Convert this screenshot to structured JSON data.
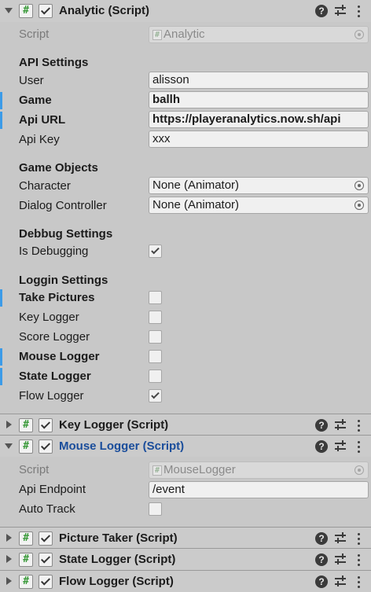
{
  "components": {
    "analytic": {
      "title": "Analytic (Script)",
      "script_label": "Script",
      "script_value": "Analytic",
      "api_section": "API Settings",
      "user_label": "User",
      "user_value": "alisson",
      "game_label": "Game",
      "game_value": "ballh",
      "api_url_label": "Api URL",
      "api_url_value": "https://playeranalytics.now.sh/api",
      "api_key_label": "Api Key",
      "api_key_value": "xxx",
      "go_section": "Game Objects",
      "character_label": "Character",
      "character_value": "None (Animator)",
      "dialog_label": "Dialog Controller",
      "dialog_value": "None (Animator)",
      "debug_section": "Debbug Settings",
      "is_debugging_label": "Is Debugging",
      "is_debugging": true,
      "loggin_section": "Loggin Settings",
      "take_pictures_label": "Take Pictures",
      "take_pictures": false,
      "key_logger_label": "Key Logger",
      "key_logger": false,
      "score_logger_label": "Score Logger",
      "score_logger": false,
      "mouse_logger_label": "Mouse Logger",
      "mouse_logger": false,
      "state_logger_label": "State Logger",
      "state_logger": false,
      "flow_logger_label": "Flow Logger",
      "flow_logger": true
    },
    "key_logger": {
      "title": "Key Logger (Script)"
    },
    "mouse_logger": {
      "title": "Mouse Logger (Script)",
      "script_label": "Script",
      "script_value": "MouseLogger",
      "endpoint_label": "Api Endpoint",
      "endpoint_value": "/event",
      "auto_track_label": "Auto Track",
      "auto_track": false
    },
    "picture_taker": {
      "title": "Picture Taker (Script)"
    },
    "state_logger": {
      "title": "State Logger (Script)"
    },
    "flow_logger": {
      "title": "Flow Logger (Script)"
    }
  },
  "icons": {
    "script": "script-icon",
    "help": "help-icon",
    "presets": "presets-icon",
    "context_menu": "kebab-menu-icon",
    "object_picker": "object-picker-icon"
  },
  "colors": {
    "modified_bar": "#3c9be8",
    "selected_title": "#1a4d9b",
    "panel_bg": "#c8c8c8"
  }
}
